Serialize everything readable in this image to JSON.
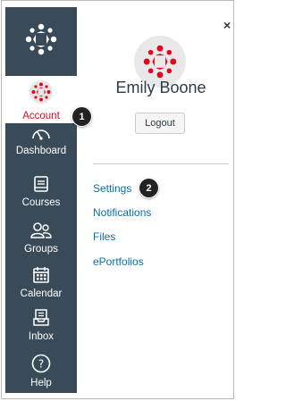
{
  "nav": {
    "items": [
      {
        "label": "Account",
        "icon": "account-avatar-icon",
        "active": true
      },
      {
        "label": "Dashboard",
        "icon": "dashboard-icon"
      },
      {
        "label": "Courses",
        "icon": "courses-icon"
      },
      {
        "label": "Groups",
        "icon": "groups-icon"
      },
      {
        "label": "Calendar",
        "icon": "calendar-icon"
      },
      {
        "label": "Inbox",
        "icon": "inbox-icon"
      },
      {
        "label": "Help",
        "icon": "help-icon"
      }
    ]
  },
  "tray": {
    "user_name": "Emily Boone",
    "logout_label": "Logout",
    "close_label": "×",
    "links": [
      "Settings",
      "Notifications",
      "Files",
      "ePortfolios"
    ]
  },
  "badges": {
    "first": "1",
    "second": "2"
  },
  "colors": {
    "nav_bg": "#394b58",
    "brand_red": "#e0061f",
    "link_blue": "#0770a3"
  }
}
